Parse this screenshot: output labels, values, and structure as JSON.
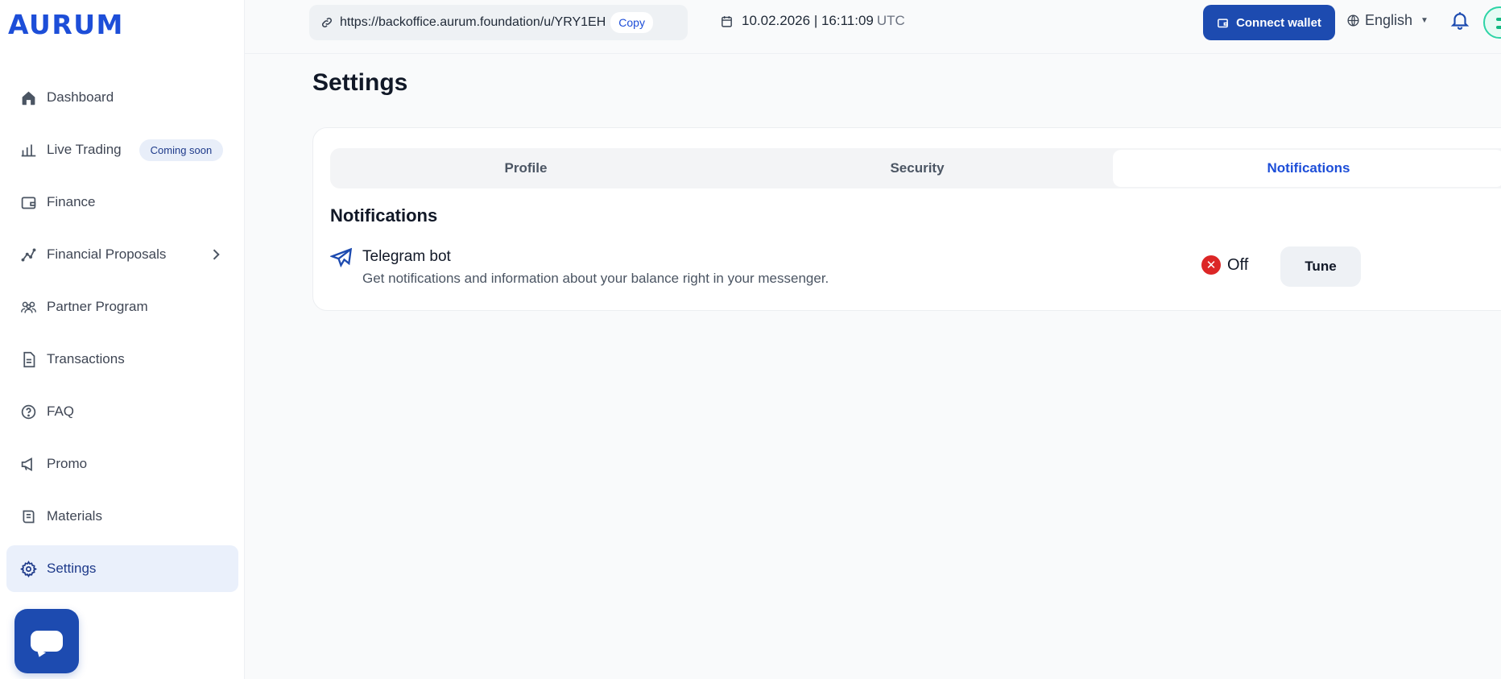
{
  "brand": {
    "logo_text": "AURUM",
    "accent": "#1d4bb0"
  },
  "header": {
    "ref_url": "https://backoffice.aurum.foundation/u/YRY1EH",
    "copy_label": "Copy",
    "date": "10.02.2026",
    "time": "| 16:11:09",
    "timezone": "UTC",
    "connect_label": "Connect wallet",
    "language": "English"
  },
  "sidebar": {
    "items": [
      {
        "label": "Dashboard",
        "icon": "home-icon"
      },
      {
        "label": "Live Trading",
        "icon": "bar-chart-icon",
        "badge": "Coming soon"
      },
      {
        "label": "Finance",
        "icon": "wallet-icon"
      },
      {
        "label": "Financial Proposals",
        "icon": "trend-icon"
      },
      {
        "label": "Partner Program",
        "icon": "users-icon"
      },
      {
        "label": "Transactions",
        "icon": "document-icon"
      },
      {
        "label": "FAQ",
        "icon": "question-icon"
      },
      {
        "label": "Promo",
        "icon": "megaphone-icon"
      },
      {
        "label": "Materials",
        "icon": "scroll-icon"
      },
      {
        "label": "Settings",
        "icon": "gear-icon",
        "active": true
      }
    ]
  },
  "main": {
    "title": "Settings",
    "tabs": [
      {
        "label": "Profile"
      },
      {
        "label": "Security"
      },
      {
        "label": "Notifications",
        "active": true
      }
    ],
    "section_title": "Notifications",
    "notification": {
      "name": "Telegram bot",
      "description": "Get notifications and information about your balance right in your messenger.",
      "status": "Off",
      "status_color": "#dc2626",
      "button_label": "Tune"
    }
  }
}
